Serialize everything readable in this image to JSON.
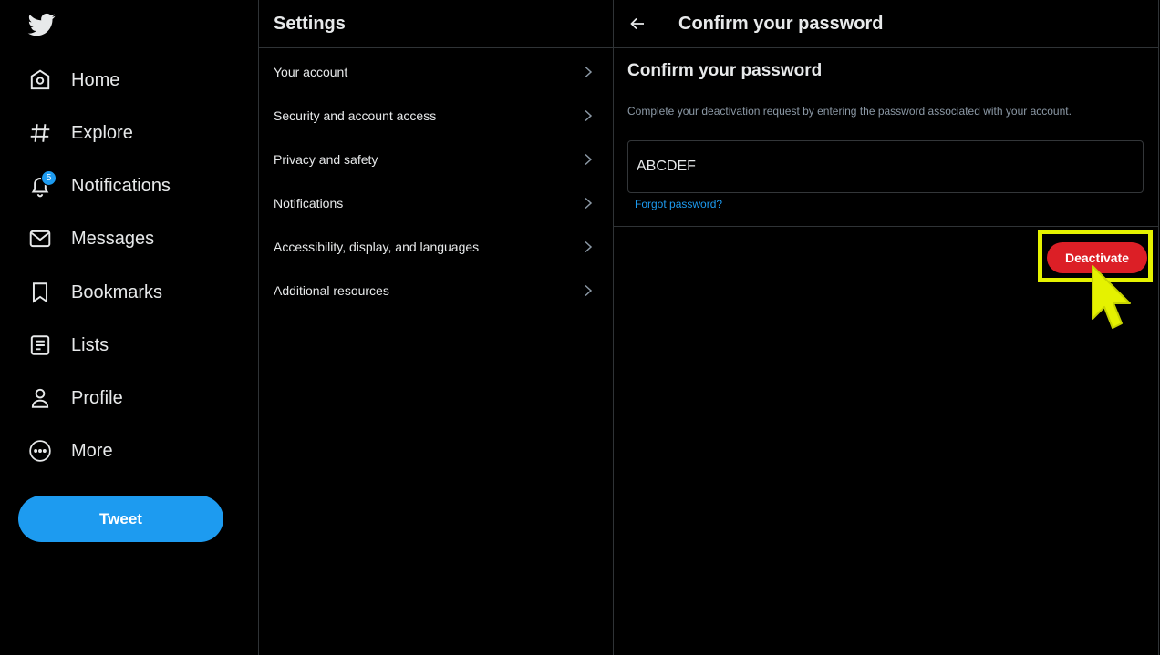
{
  "nav": {
    "logo_icon": "twitter-bird-icon",
    "items": [
      {
        "label": "Home",
        "icon": "home-icon"
      },
      {
        "label": "Explore",
        "icon": "hashtag-icon"
      },
      {
        "label": "Notifications",
        "icon": "bell-icon",
        "badge": "5"
      },
      {
        "label": "Messages",
        "icon": "envelope-icon"
      },
      {
        "label": "Bookmarks",
        "icon": "bookmark-icon"
      },
      {
        "label": "Lists",
        "icon": "list-icon"
      },
      {
        "label": "Profile",
        "icon": "person-icon"
      },
      {
        "label": "More",
        "icon": "more-circle-icon"
      }
    ],
    "tweet_label": "Tweet"
  },
  "settings": {
    "title": "Settings",
    "items": [
      {
        "label": "Your account"
      },
      {
        "label": "Security and account access"
      },
      {
        "label": "Privacy and safety"
      },
      {
        "label": "Notifications"
      },
      {
        "label": "Accessibility, display, and languages"
      },
      {
        "label": "Additional resources"
      }
    ]
  },
  "detail": {
    "header_title": "Confirm your password",
    "section_title": "Confirm your password",
    "description": "Complete your deactivation request by entering the password associated with your account.",
    "password_value": "ABCDEF",
    "forgot_label": "Forgot password?",
    "deactivate_label": "Deactivate"
  },
  "colors": {
    "accent": "#1d9bf0",
    "danger": "#dc1f26",
    "highlight": "#e5f200",
    "background": "#000000"
  }
}
